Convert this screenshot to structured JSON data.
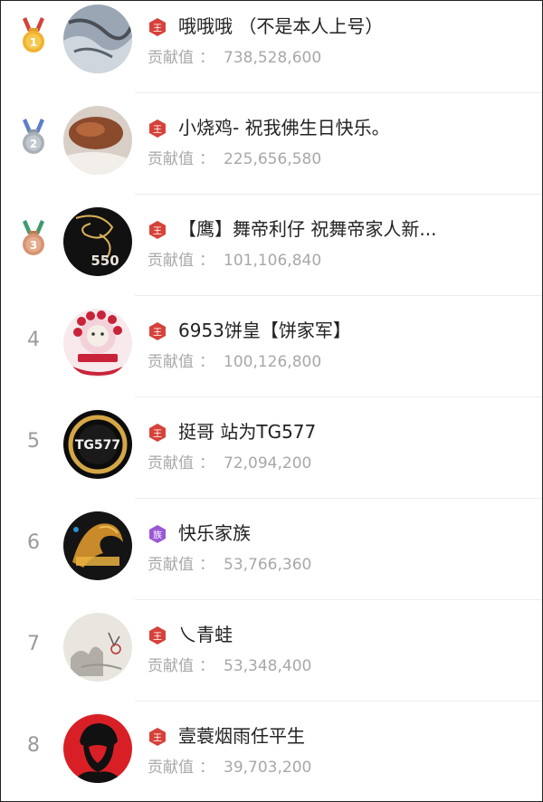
{
  "contribution_label": "贡献值",
  "colon": "：",
  "rows": [
    {
      "rank": "1",
      "name": "哦哦哦 （不是本人上号）",
      "value": "738,528,600",
      "medal": "gold",
      "badge": "red"
    },
    {
      "rank": "2",
      "name": "小烧鸡- 祝我佛生日快乐。",
      "value": "225,656,580",
      "medal": "silver",
      "badge": "red"
    },
    {
      "rank": "3",
      "name": "【鹰】舞帝利仔  祝舞帝家人新...",
      "value": "101,106,840",
      "medal": "bronze",
      "badge": "red",
      "avatar_text": "550"
    },
    {
      "rank": "4",
      "name": "6953饼皇【饼家军】",
      "value": "100,126,800",
      "badge": "red"
    },
    {
      "rank": "5",
      "name": "挺哥 站为TG577",
      "value": "72,094,200",
      "badge": "red",
      "avatar_text": "TG577"
    },
    {
      "rank": "6",
      "name": "快乐家族",
      "value": "53,766,360",
      "badge": "purple"
    },
    {
      "rank": "7",
      "name": "乀青蛙",
      "value": "53,348,400",
      "badge": "red"
    },
    {
      "rank": "8",
      "name": "壹蓑烟雨任平生",
      "value": "39,703,200",
      "badge": "red"
    }
  ],
  "colors": {
    "gold": "#f0b230",
    "silver": "#a9b0b8",
    "bronze": "#d69472",
    "badge_red": "#d6423a",
    "badge_purple": "#9a57d6"
  }
}
